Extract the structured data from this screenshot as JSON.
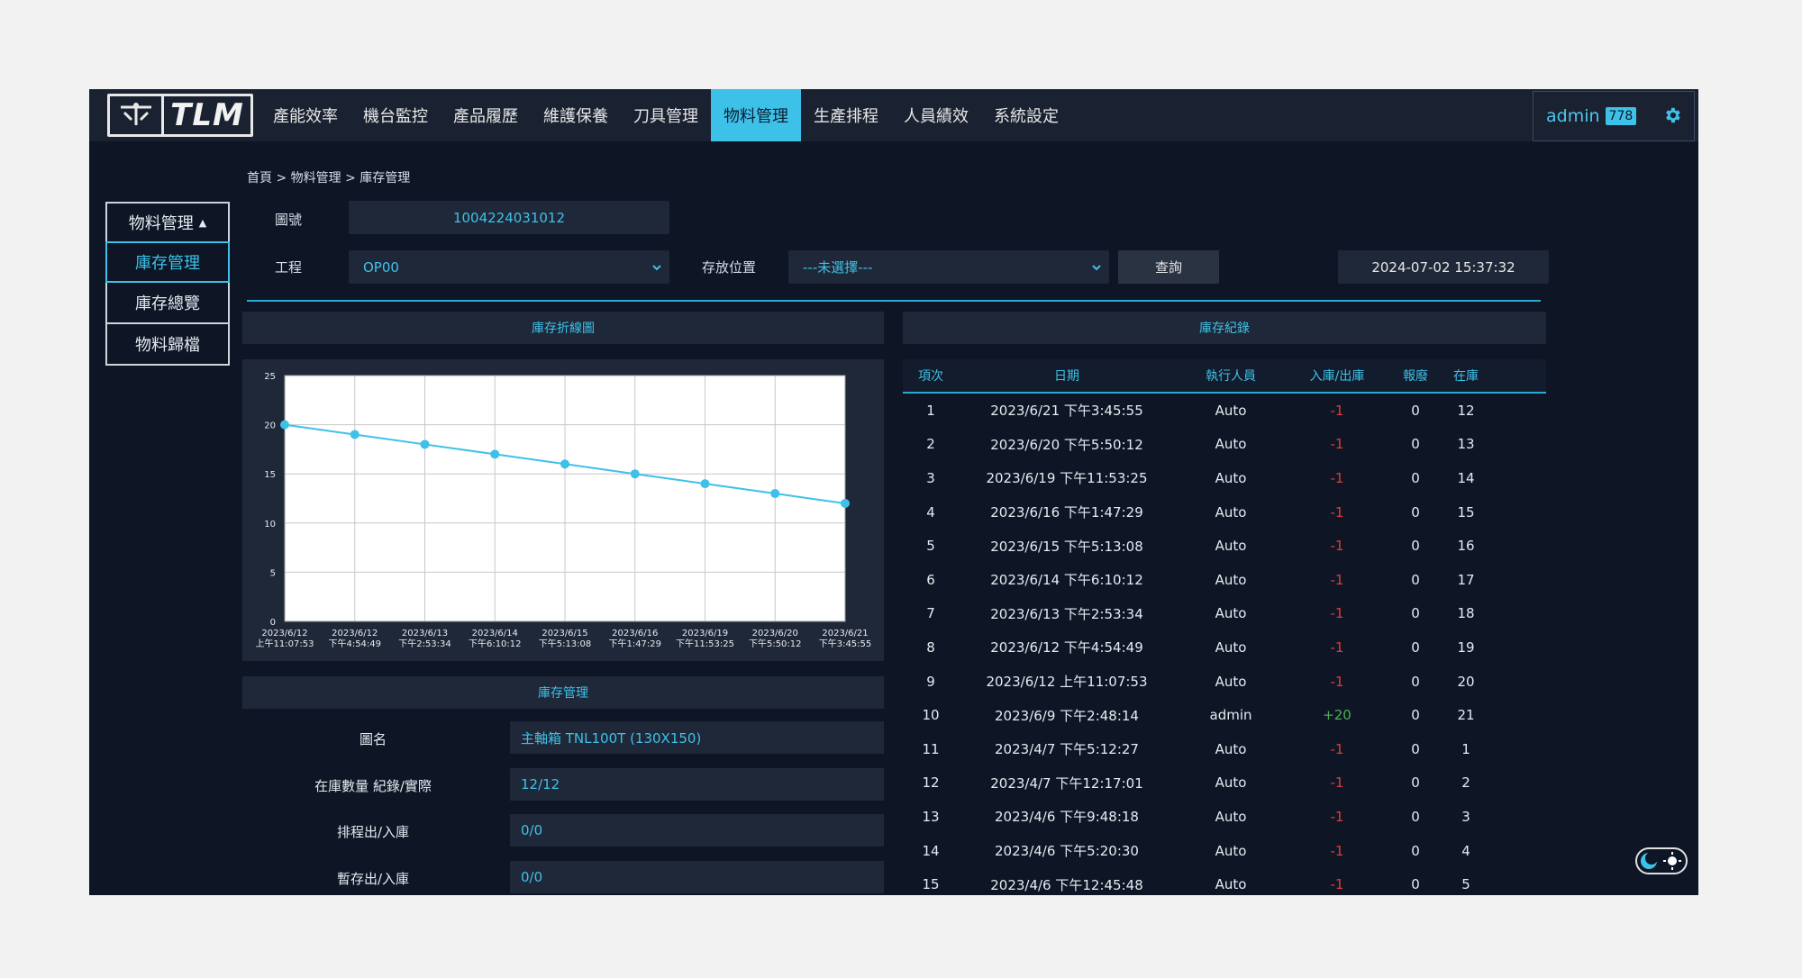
{
  "nav": {
    "logo_text": "TLM",
    "items": [
      "產能效率",
      "機台監控",
      "產品履歷",
      "維護保養",
      "刀具管理",
      "物料管理",
      "生產排程",
      "人員績效",
      "系統設定"
    ],
    "active_index": 5
  },
  "user": {
    "name": "admin",
    "badge": "778"
  },
  "breadcrumb": "首頁 > 物料管理 > 庫存管理",
  "side_menu": {
    "header": "物料管理",
    "items": [
      "庫存管理",
      "庫存總覽",
      "物料歸檔"
    ],
    "active_index": 0
  },
  "filters": {
    "drawing_no_label": "圖號",
    "drawing_no_value": "1004224031012",
    "process_label": "工程",
    "process_value": "OP00",
    "location_label": "存放位置",
    "location_value": "---未選擇---",
    "query_button": "查詢",
    "timestamp": "2024-07-02 15:37:32"
  },
  "chart_panel": {
    "title": "庫存折線圖"
  },
  "chart_data": {
    "type": "line",
    "categories": [
      [
        "2023/6/12",
        "上午11:07:53"
      ],
      [
        "2023/6/12",
        "下午4:54:49"
      ],
      [
        "2023/6/13",
        "下午2:53:34"
      ],
      [
        "2023/6/14",
        "下午6:10:12"
      ],
      [
        "2023/6/15",
        "下午5:13:08"
      ],
      [
        "2023/6/16",
        "下午1:47:29"
      ],
      [
        "2023/6/19",
        "下午11:53:25"
      ],
      [
        "2023/6/20",
        "下午5:50:12"
      ],
      [
        "2023/6/21",
        "下午3:45:55"
      ]
    ],
    "values": [
      20,
      19,
      18,
      17,
      16,
      15,
      14,
      13,
      12
    ],
    "ylim": [
      0,
      25
    ],
    "yticks": [
      0,
      5,
      10,
      15,
      20,
      25
    ],
    "grid": true,
    "line_color": "#3ec1e8"
  },
  "records_panel": {
    "title": "庫存紀錄",
    "columns": [
      "項次",
      "日期",
      "執行人員",
      "入庫/出庫",
      "報廢",
      "在庫"
    ],
    "rows": [
      [
        "1",
        "2023/6/21 下午3:45:55",
        "Auto",
        "-1",
        "0",
        "12"
      ],
      [
        "2",
        "2023/6/20 下午5:50:12",
        "Auto",
        "-1",
        "0",
        "13"
      ],
      [
        "3",
        "2023/6/19 下午11:53:25",
        "Auto",
        "-1",
        "0",
        "14"
      ],
      [
        "4",
        "2023/6/16 下午1:47:29",
        "Auto",
        "-1",
        "0",
        "15"
      ],
      [
        "5",
        "2023/6/15 下午5:13:08",
        "Auto",
        "-1",
        "0",
        "16"
      ],
      [
        "6",
        "2023/6/14 下午6:10:12",
        "Auto",
        "-1",
        "0",
        "17"
      ],
      [
        "7",
        "2023/6/13 下午2:53:34",
        "Auto",
        "-1",
        "0",
        "18"
      ],
      [
        "8",
        "2023/6/12 下午4:54:49",
        "Auto",
        "-1",
        "0",
        "19"
      ],
      [
        "9",
        "2023/6/12 上午11:07:53",
        "Auto",
        "-1",
        "0",
        "20"
      ],
      [
        "10",
        "2023/6/9 下午2:48:14",
        "admin",
        "+20",
        "0",
        "21"
      ],
      [
        "11",
        "2023/4/7 下午5:12:27",
        "Auto",
        "-1",
        "0",
        "1"
      ],
      [
        "12",
        "2023/4/7 下午12:17:01",
        "Auto",
        "-1",
        "0",
        "2"
      ],
      [
        "13",
        "2023/4/6 下午9:48:18",
        "Auto",
        "-1",
        "0",
        "3"
      ],
      [
        "14",
        "2023/4/6 下午5:20:30",
        "Auto",
        "-1",
        "0",
        "4"
      ],
      [
        "15",
        "2023/4/6 下午12:45:48",
        "Auto",
        "-1",
        "0",
        "5"
      ]
    ]
  },
  "inventory_panel": {
    "title": "庫存管理",
    "fields": [
      {
        "label": "圖名",
        "value": "主軸箱 TNL100T (130X150)"
      },
      {
        "label": "在庫數量 紀錄/實際",
        "value": "12/12"
      },
      {
        "label": "排程出/入庫",
        "value": "0/0"
      },
      {
        "label": "暫存出/入庫",
        "value": "0/0"
      }
    ]
  }
}
